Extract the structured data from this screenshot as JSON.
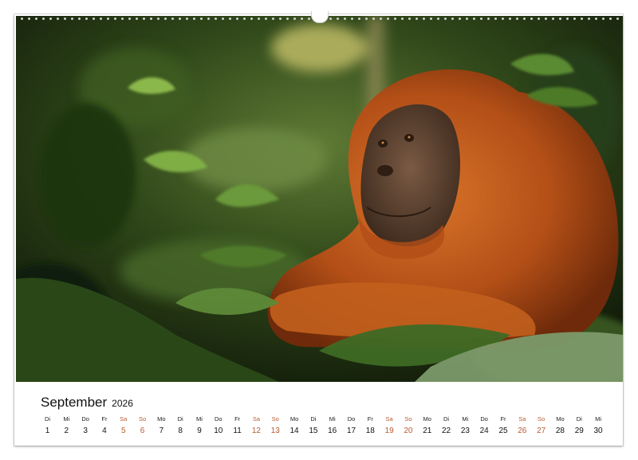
{
  "calendar": {
    "month": "September",
    "year": "2026",
    "weekend_color": "#b85a2f",
    "days": [
      {
        "name": "Di",
        "num": "1",
        "weekend": false
      },
      {
        "name": "Mi",
        "num": "2",
        "weekend": false
      },
      {
        "name": "Do",
        "num": "3",
        "weekend": false
      },
      {
        "name": "Fr",
        "num": "4",
        "weekend": false
      },
      {
        "name": "Sa",
        "num": "5",
        "weekend": true
      },
      {
        "name": "So",
        "num": "6",
        "weekend": true
      },
      {
        "name": "Mo",
        "num": "7",
        "weekend": false
      },
      {
        "name": "Di",
        "num": "8",
        "weekend": false
      },
      {
        "name": "Mi",
        "num": "9",
        "weekend": false
      },
      {
        "name": "Do",
        "num": "10",
        "weekend": false
      },
      {
        "name": "Fr",
        "num": "11",
        "weekend": false
      },
      {
        "name": "Sa",
        "num": "12",
        "weekend": true
      },
      {
        "name": "So",
        "num": "13",
        "weekend": true
      },
      {
        "name": "Mo",
        "num": "14",
        "weekend": false
      },
      {
        "name": "Di",
        "num": "15",
        "weekend": false
      },
      {
        "name": "Mi",
        "num": "16",
        "weekend": false
      },
      {
        "name": "Do",
        "num": "17",
        "weekend": false
      },
      {
        "name": "Fr",
        "num": "18",
        "weekend": false
      },
      {
        "name": "Sa",
        "num": "19",
        "weekend": true
      },
      {
        "name": "So",
        "num": "20",
        "weekend": true
      },
      {
        "name": "Mo",
        "num": "21",
        "weekend": false
      },
      {
        "name": "Di",
        "num": "22",
        "weekend": false
      },
      {
        "name": "Mi",
        "num": "23",
        "weekend": false
      },
      {
        "name": "Do",
        "num": "24",
        "weekend": false
      },
      {
        "name": "Fr",
        "num": "25",
        "weekend": false
      },
      {
        "name": "Sa",
        "num": "26",
        "weekend": true
      },
      {
        "name": "So",
        "num": "27",
        "weekend": true
      },
      {
        "name": "Mo",
        "num": "28",
        "weekend": false
      },
      {
        "name": "Di",
        "num": "29",
        "weekend": false
      },
      {
        "name": "Mi",
        "num": "30",
        "weekend": false
      }
    ]
  }
}
